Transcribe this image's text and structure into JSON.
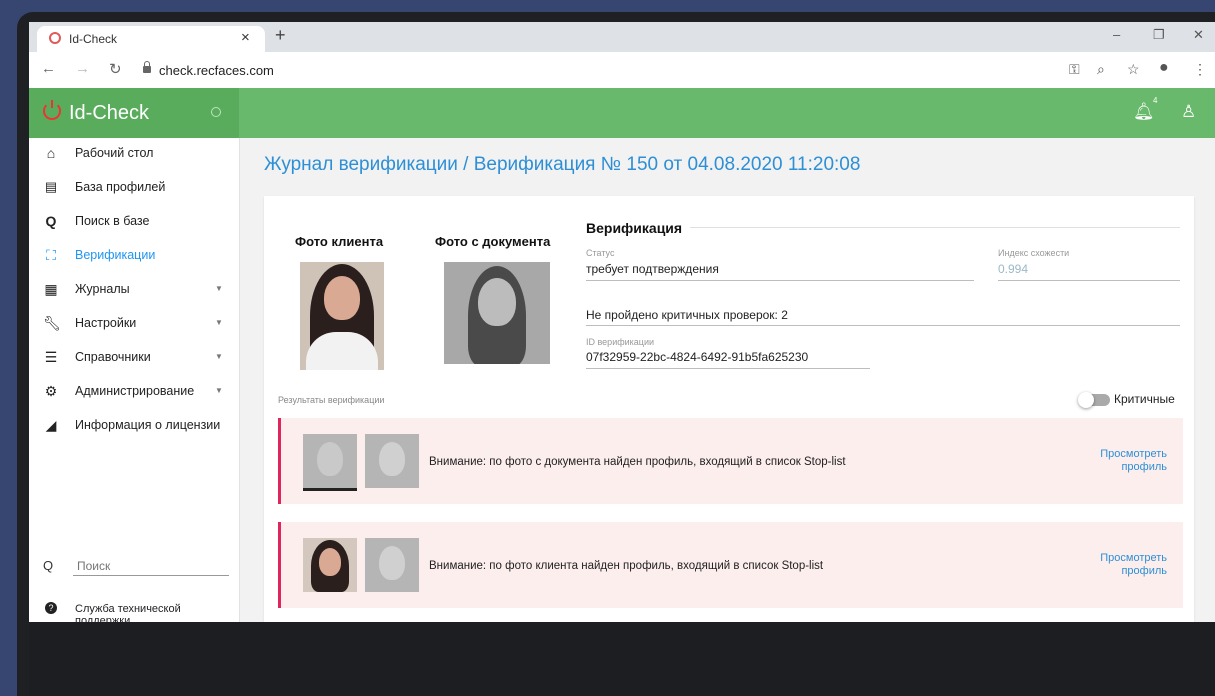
{
  "browser": {
    "tab_title": "Id-Check",
    "tab_close": "×",
    "new_tab": "+",
    "url": "check.recfaces.com",
    "win_minimize": "–",
    "win_restore": "❐",
    "win_close": "✕"
  },
  "header": {
    "brand": "Id-Check",
    "notification_count": "4"
  },
  "sidebar": {
    "items": [
      {
        "label": "Рабочий стол",
        "icon": "home-icon"
      },
      {
        "label": "База профилей",
        "icon": "id-card-icon"
      },
      {
        "label": "Поиск в базе",
        "icon": "search-icon"
      },
      {
        "label": "Верификации",
        "icon": "scan-icon",
        "active": true
      },
      {
        "label": "Журналы",
        "icon": "table-icon"
      },
      {
        "label": "Настройки",
        "icon": "wrench-icon"
      },
      {
        "label": "Справочники",
        "icon": "list-icon"
      },
      {
        "label": "Администрирование",
        "icon": "gear-icon"
      },
      {
        "label": "Информация о лицензии",
        "icon": "license-icon"
      }
    ],
    "search_placeholder": "Поиск",
    "support": "Служба технической поддержки"
  },
  "main": {
    "page_title": "Журнал верификации / Верификация № 150 от 04.08.2020 11:20:08",
    "photo_client_label": "Фото клиента",
    "photo_doc_label": "Фото с документа",
    "verification": {
      "title": "Верификация",
      "status_label": "Статус",
      "status_value": "требует подтверждения",
      "similarity_label": "Индекс схожести",
      "similarity_value": "0.994",
      "critical_checks": "Не пройдено критичных проверок: 2",
      "id_label": "ID верификации",
      "id_value": "07f32959-22bc-4824-6492-91b5fa625230"
    },
    "results_label": "Результаты верификации",
    "critical_toggle_label": "Критичные",
    "alerts": [
      {
        "text": "Внимание: по фото с документа найден профиль, входящий в список Stop-list",
        "link": "Просмотреть профиль"
      },
      {
        "text": "Внимание: по фото клиента найден профиль, входящий в список Stop-list",
        "link": "Просмотреть профиль"
      }
    ]
  },
  "colors": {
    "header_green": "#68b96b",
    "accent_blue": "#2d8fd5",
    "alert_red": "#e0245e"
  }
}
